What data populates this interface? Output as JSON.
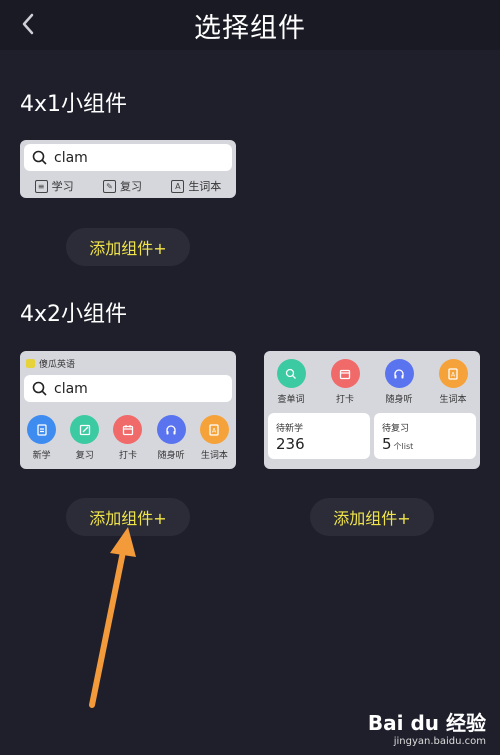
{
  "header": {
    "title": "选择组件"
  },
  "sections": [
    {
      "title": "4x1小组件"
    },
    {
      "title": "4x2小组件"
    }
  ],
  "widget_4x1": {
    "search_text": "clam",
    "tabs": [
      "学习",
      "复习",
      "生词本"
    ],
    "add_label": "添加组件+"
  },
  "widget_4x2_a": {
    "brand": "傻瓜英语",
    "search_text": "clam",
    "icons": [
      {
        "label": "新学",
        "color": "#3f8cf0",
        "icon": "doc-icon"
      },
      {
        "label": "复习",
        "color": "#3ccaa2",
        "icon": "edit-icon"
      },
      {
        "label": "打卡",
        "color": "#f06a6a",
        "icon": "calendar-icon"
      },
      {
        "label": "随身听",
        "color": "#5a74f0",
        "icon": "headphones-icon"
      },
      {
        "label": "生词本",
        "color": "#f5a23a",
        "icon": "notebook-icon"
      }
    ],
    "add_label": "添加组件+"
  },
  "widget_4x2_b": {
    "icons": [
      {
        "label": "查单词",
        "color": "#3ccaa2",
        "icon": "search-icon"
      },
      {
        "label": "打卡",
        "color": "#f06a6a",
        "icon": "calendar-icon"
      },
      {
        "label": "随身听",
        "color": "#5a74f0",
        "icon": "headphones-icon"
      },
      {
        "label": "生词本",
        "color": "#f5a23a",
        "icon": "notebook-icon"
      }
    ],
    "stats": [
      {
        "label": "待新学",
        "value": "236",
        "unit": ""
      },
      {
        "label": "待复习",
        "value": "5",
        "unit": "个list"
      }
    ],
    "add_label": "添加组件+"
  },
  "watermark": {
    "logo": "Bai du 经验",
    "url": "jingyan.baidu.com"
  }
}
